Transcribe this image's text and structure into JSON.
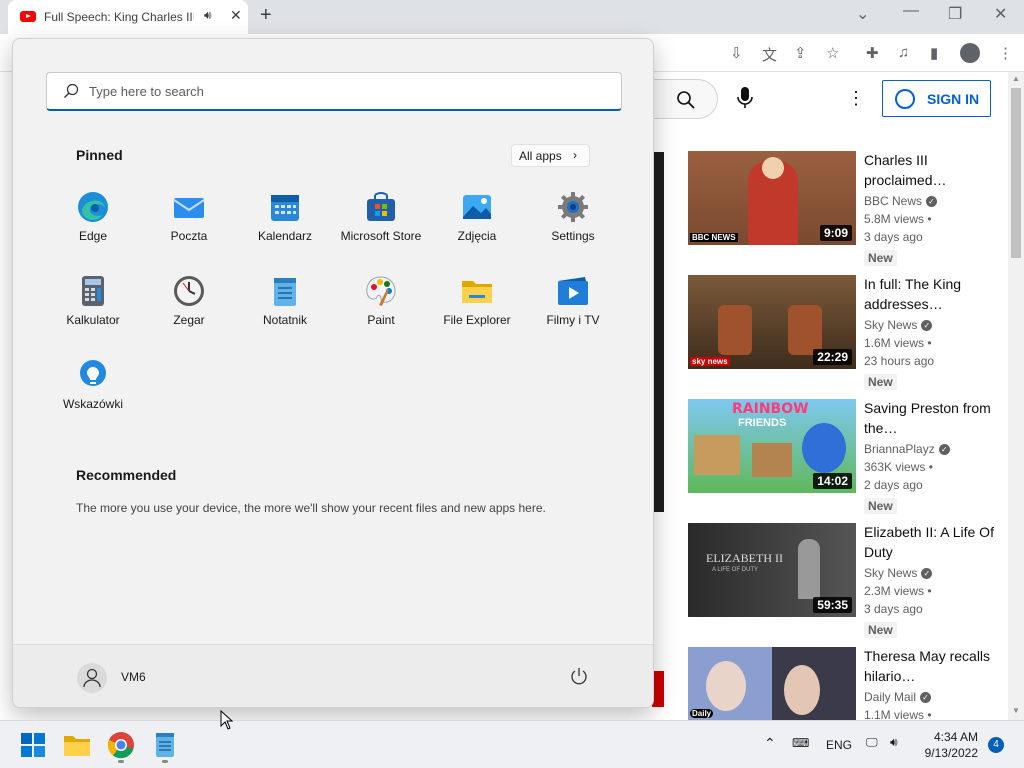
{
  "browser": {
    "tab_title": "Full Speech: King Charles III (",
    "tab_audio_icon": "speaker-icon",
    "tab_close": "✕",
    "new_tab": "+",
    "window_controls": [
      "chevron-down-icon",
      "minimize-icon",
      "restore-icon",
      "close-icon"
    ],
    "toolbar_icons": [
      "install-icon",
      "translate-icon",
      "share-icon",
      "bookmark-star-icon",
      "extensions-icon",
      "media-icon",
      "side-panel-icon",
      "profile-icon",
      "menu-icon"
    ]
  },
  "youtube": {
    "sign_in": "SIGN IN",
    "videos": [
      {
        "title": "Charles III proclaimed…",
        "channel": "BBC News",
        "views": "5.8M views •",
        "age": "3 days ago",
        "badge": "New",
        "duration": "9:09",
        "logo": "BBC NEWS",
        "color": "#8a5a3a"
      },
      {
        "title": "In full: The King addresses…",
        "channel": "Sky News",
        "views": "1.6M views •",
        "age": "23 hours ago",
        "badge": "New",
        "duration": "22:29",
        "logo": "sky news",
        "color": "#6b4a2e"
      },
      {
        "title": "Saving Preston from the…",
        "channel": "BriannaPlayz",
        "views": "363K views •",
        "age": "2 days ago",
        "badge": "New",
        "duration": "14:02",
        "logo": "",
        "color": "#3fa34d"
      },
      {
        "title": "Elizabeth II: A Life Of Duty",
        "channel": "Sky News",
        "views": "2.3M views •",
        "age": "3 days ago",
        "badge": "New",
        "duration": "59:35",
        "logo": "",
        "color": "#3a3a3a"
      },
      {
        "title": "Theresa May recalls hilario…",
        "channel": "Daily Mail",
        "views": "1.1M views •",
        "age": "",
        "badge": "",
        "duration": "",
        "logo": "Daily",
        "color": "#7a8fb8"
      }
    ],
    "thumb_texts": {
      "rainbow": "RAINBOW",
      "friends": "FRIENDS",
      "elizabeth": "ELIZABETH II",
      "elizabeth_sub": "A LIFE OF DUTY"
    }
  },
  "start_menu": {
    "search_placeholder": "Type here to search",
    "pinned_title": "Pinned",
    "all_apps": "All apps",
    "apps": [
      {
        "label": "Edge",
        "icon": "edge-icon"
      },
      {
        "label": "Poczta",
        "icon": "mail-icon"
      },
      {
        "label": "Kalendarz",
        "icon": "calendar-icon"
      },
      {
        "label": "Microsoft Store",
        "icon": "store-icon"
      },
      {
        "label": "Zdjęcia",
        "icon": "photos-icon"
      },
      {
        "label": "Settings",
        "icon": "gear-icon"
      },
      {
        "label": "Kalkulator",
        "icon": "calculator-icon"
      },
      {
        "label": "Zegar",
        "icon": "clock-icon"
      },
      {
        "label": "Notatnik",
        "icon": "notepad-icon"
      },
      {
        "label": "Paint",
        "icon": "paint-icon"
      },
      {
        "label": "File Explorer",
        "icon": "folder-icon"
      },
      {
        "label": "Filmy i TV",
        "icon": "movies-icon"
      },
      {
        "label": "Wskazówki",
        "icon": "tips-icon"
      }
    ],
    "recommended_title": "Recommended",
    "recommended_text": "The more you use your device, the more we'll show your recent files and new apps here.",
    "user_name": "VM6"
  },
  "taskbar": {
    "apps": [
      "start-icon",
      "file-explorer-icon",
      "chrome-icon",
      "notepad-icon"
    ],
    "language": "ENG",
    "time": "4:34 AM",
    "date": "9/13/2022",
    "notifications": "4"
  }
}
